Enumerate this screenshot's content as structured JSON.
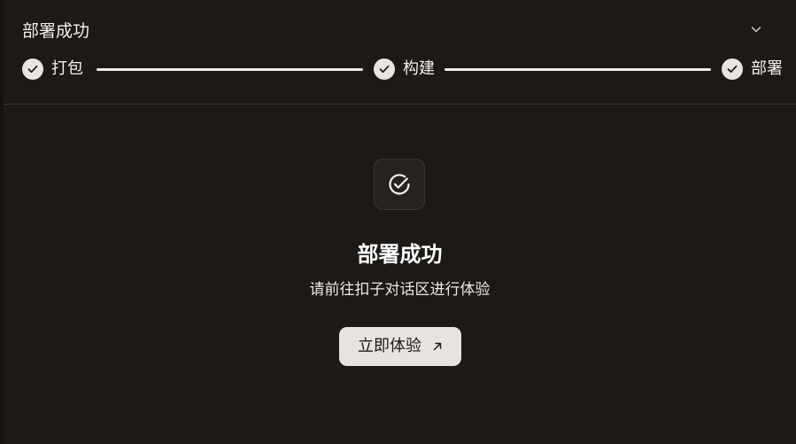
{
  "header": {
    "title": "部署成功",
    "collapse_icon": "chevron-down-icon"
  },
  "steps": [
    {
      "label": "打包",
      "status": "done",
      "icon": "check-icon"
    },
    {
      "label": "构建",
      "status": "done",
      "icon": "check-icon"
    },
    {
      "label": "部署",
      "status": "done",
      "icon": "check-icon"
    }
  ],
  "result": {
    "icon": "check-circle-icon",
    "title": "部署成功",
    "description": "请前往扣子对话区进行体验",
    "action_label": "立即体验",
    "action_icon": "arrow-up-right-icon"
  },
  "colors": {
    "background": "#1c1917",
    "step_check_bg": "#e8e5e1",
    "button_bg": "#e7e4e0",
    "text": "#f2f0ee"
  }
}
